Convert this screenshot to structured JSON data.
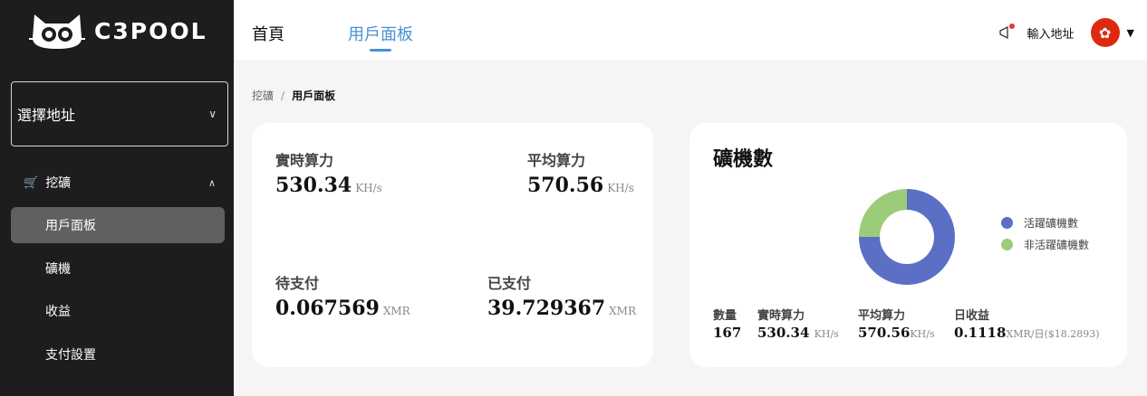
{
  "brand": {
    "name": "C3POOL"
  },
  "sidebar": {
    "address_select": {
      "label": "選擇地址"
    },
    "group": {
      "label": "挖礦"
    },
    "items": [
      {
        "label": "用戶面板",
        "active": true
      },
      {
        "label": "礦機"
      },
      {
        "label": "收益"
      },
      {
        "label": "支付設置"
      }
    ]
  },
  "header": {
    "tabs": [
      {
        "label": "首頁"
      },
      {
        "label": "用戶面板",
        "active": true
      }
    ],
    "enter_address": "輸入地址"
  },
  "breadcrumb": {
    "root": "挖礦",
    "sep": "/",
    "current": "用戶面板"
  },
  "stats": {
    "realtime": {
      "label": "實時算力",
      "value": "530.34",
      "unit": "KH/s"
    },
    "average": {
      "label": "平均算力",
      "value": "570.56",
      "unit": "KH/s"
    },
    "pending": {
      "label": "待支付",
      "value": "0.067569",
      "unit": "XMR"
    },
    "paid": {
      "label": "已支付",
      "value": "39.729367",
      "unit": "XMR"
    }
  },
  "miners": {
    "title": "礦機數",
    "legend": [
      {
        "label": "活躍礦機數",
        "color": "#5b6fc4",
        "share": 0.75
      },
      {
        "label": "非活躍礦機數",
        "color": "#9ccc7a",
        "share": 0.25
      }
    ],
    "summary": {
      "count": {
        "label": "數量",
        "value": "167"
      },
      "realtime": {
        "label": "實時算力",
        "value": "530.34",
        "unit": "KH/s"
      },
      "average": {
        "label": "平均算力",
        "value": "570.56",
        "unit": "KH/s"
      },
      "daily": {
        "label": "日收益",
        "value": "0.1118",
        "unit": "XMR/日($18.2893)"
      }
    }
  },
  "colors": {
    "sidebar_bg": "#1d1d1f",
    "accent": "#4a8fd6",
    "active_item": "#606060"
  }
}
